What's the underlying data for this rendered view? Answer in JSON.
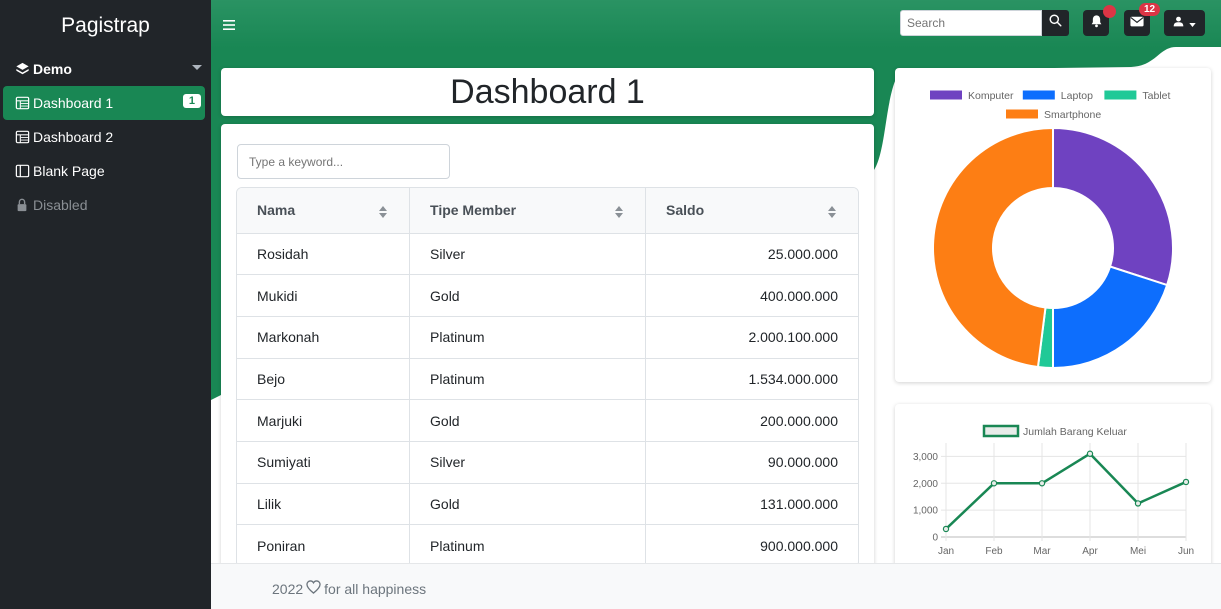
{
  "sidebar": {
    "brand": "Pagistrap",
    "items": [
      {
        "label": "Demo"
      },
      {
        "label": "Dashboard 1",
        "badge": "1"
      },
      {
        "label": "Dashboard 2"
      },
      {
        "label": "Blank Page"
      },
      {
        "label": "Disabled"
      }
    ]
  },
  "topbar": {
    "search_placeholder": "Search",
    "mail_count": "12"
  },
  "title": "Dashboard 1",
  "table": {
    "keyword_placeholder": "Type a keyword...",
    "headers": [
      "Nama",
      "Tipe Member",
      "Saldo"
    ],
    "rows": [
      [
        "Rosidah",
        "Silver",
        "25.000.000"
      ],
      [
        "Mukidi",
        "Gold",
        "400.000.000"
      ],
      [
        "Markonah",
        "Platinum",
        "2.000.100.000"
      ],
      [
        "Bejo",
        "Platinum",
        "1.534.000.000"
      ],
      [
        "Marjuki",
        "Gold",
        "200.000.000"
      ],
      [
        "Sumiyati",
        "Silver",
        "90.000.000"
      ],
      [
        "Lilik",
        "Gold",
        "131.000.000"
      ],
      [
        "Poniran",
        "Platinum",
        "900.000.000"
      ]
    ]
  },
  "footer": {
    "year": "2022",
    "text": "for all happiness"
  },
  "colors": {
    "brand_green": "#198754",
    "sidebar_bg": "#212529",
    "badge_red": "#dc3545"
  },
  "chart_data": [
    {
      "type": "pie",
      "categories": [
        "Komputer",
        "Laptop",
        "Tablet",
        "Smartphone"
      ],
      "values": [
        30,
        20,
        2,
        48
      ],
      "colors": [
        "#6f42c1",
        "#0d6efd",
        "#20c997",
        "#fd7e14"
      ],
      "legend": "top"
    },
    {
      "type": "line",
      "categories": [
        "Jan",
        "Feb",
        "Mar",
        "Apr",
        "Mei",
        "Jun"
      ],
      "series": [
        {
          "name": "Jumlah Barang Keluar",
          "values": [
            300,
            2000,
            2000,
            3100,
            1250,
            2050
          ]
        }
      ],
      "ylim": [
        0,
        3500
      ],
      "yticks": [
        "0",
        "1,000",
        "2,000",
        "3,000"
      ],
      "grid": true,
      "legend": "top",
      "color": "#198754"
    }
  ]
}
